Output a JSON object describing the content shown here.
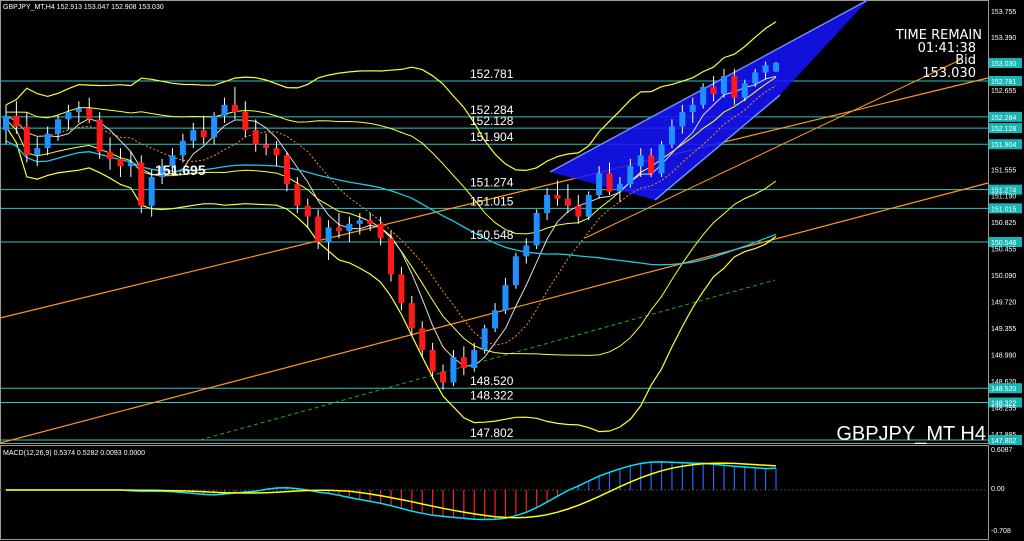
{
  "window": {
    "info_line": "GBPJPY_MT,H4  152.913 153.047 152.908 153.030"
  },
  "top_right": {
    "line1": "TIME REMAIN",
    "line2": "01:41:38",
    "line3": "Bid",
    "line4": "153.030"
  },
  "symbol_label": "GBPJPY_MT H4",
  "macd": {
    "label": "MACD(12,26,9) 0.5374 0.5282 0.0093 0.0000",
    "scale_labels": [
      "0.6087",
      "0.00",
      "-0.708"
    ],
    "colors": {
      "histogram": "#1e6bff",
      "negative": "#ff2020",
      "signal": "#ffff00",
      "main": "#00e5ff"
    }
  },
  "chart_data": {
    "type": "candlestick",
    "symbol": "GBPJPY_MT",
    "timeframe": "H4",
    "ylim": [
      147.65,
      153.95
    ],
    "price_axis_ticks": [
      "153.755",
      "153.390",
      "153.030",
      "152.781",
      "152.655",
      "152.284",
      "152.128",
      "151.904",
      "151.555",
      "151.274",
      "151.190",
      "151.015",
      "150.825",
      "150.548",
      "150.455",
      "150.090",
      "149.720",
      "149.355",
      "148.990",
      "148.620",
      "148.520",
      "148.322",
      "148.255",
      "147.885",
      "147.802"
    ],
    "horizontal_levels": [
      {
        "value": 152.781,
        "label": "152.781"
      },
      {
        "value": 152.284,
        "label": "152.284"
      },
      {
        "value": 152.128,
        "label": "152.128"
      },
      {
        "value": 151.904,
        "label": "151.904"
      },
      {
        "value": 151.274,
        "label": "151.274"
      },
      {
        "value": 151.015,
        "label": "151.015"
      },
      {
        "value": 150.548,
        "label": "150.548"
      },
      {
        "value": 148.52,
        "label": "148.520"
      },
      {
        "value": 148.322,
        "label": "148.322"
      },
      {
        "value": 147.802,
        "label": "147.802"
      }
    ],
    "highlighted_axis_labels": [
      "153.030",
      "152.781",
      "152.284",
      "152.128",
      "151.904",
      "151.274",
      "151.015",
      "150.548",
      "148.520",
      "148.322",
      "147.802"
    ],
    "annotation": "151.695",
    "candles": [
      [
        152.1,
        152.45,
        151.9,
        152.3
      ],
      [
        152.3,
        152.5,
        152.05,
        152.15
      ],
      [
        152.15,
        152.35,
        151.65,
        151.75
      ],
      [
        151.75,
        152.0,
        151.6,
        151.85
      ],
      [
        151.85,
        152.15,
        151.75,
        152.05
      ],
      [
        152.05,
        152.3,
        151.95,
        152.25
      ],
      [
        152.25,
        152.45,
        152.1,
        152.35
      ],
      [
        152.35,
        152.5,
        152.2,
        152.4
      ],
      [
        152.4,
        152.55,
        152.2,
        152.25
      ],
      [
        152.25,
        152.35,
        151.7,
        151.8
      ],
      [
        151.8,
        152.0,
        151.55,
        151.7
      ],
      [
        151.7,
        151.85,
        151.45,
        151.6
      ],
      [
        151.6,
        151.8,
        151.45,
        151.65
      ],
      [
        151.65,
        151.75,
        150.95,
        151.05
      ],
      [
        151.05,
        151.55,
        150.9,
        151.45
      ],
      [
        151.45,
        151.7,
        151.35,
        151.6
      ],
      [
        151.6,
        151.85,
        151.5,
        151.75
      ],
      [
        151.75,
        152.05,
        151.65,
        151.95
      ],
      [
        151.95,
        152.2,
        151.85,
        152.1
      ],
      [
        152.1,
        152.3,
        151.9,
        152.0
      ],
      [
        152.0,
        152.35,
        151.9,
        152.3
      ],
      [
        152.3,
        152.55,
        152.2,
        152.45
      ],
      [
        152.45,
        152.7,
        152.25,
        152.35
      ],
      [
        152.35,
        152.5,
        152.0,
        152.1
      ],
      [
        152.1,
        152.25,
        151.8,
        151.9
      ],
      [
        151.9,
        152.05,
        151.75,
        151.85
      ],
      [
        151.85,
        151.95,
        151.6,
        151.75
      ],
      [
        151.75,
        151.8,
        151.25,
        151.35
      ],
      [
        151.35,
        151.45,
        150.95,
        151.05
      ],
      [
        151.05,
        151.15,
        150.75,
        150.9
      ],
      [
        150.9,
        151.0,
        150.45,
        150.55
      ],
      [
        150.55,
        150.85,
        150.3,
        150.75
      ],
      [
        150.75,
        150.95,
        150.6,
        150.7
      ],
      [
        150.7,
        150.9,
        150.55,
        150.8
      ],
      [
        150.8,
        150.95,
        150.65,
        150.85
      ],
      [
        150.85,
        150.95,
        150.7,
        150.8
      ],
      [
        150.8,
        150.9,
        150.5,
        150.6
      ],
      [
        150.6,
        150.7,
        150.0,
        150.1
      ],
      [
        150.1,
        150.2,
        149.6,
        149.7
      ],
      [
        149.7,
        149.8,
        149.25,
        149.35
      ],
      [
        149.35,
        149.45,
        148.95,
        149.05
      ],
      [
        149.05,
        149.15,
        148.65,
        148.75
      ],
      [
        148.75,
        148.85,
        148.5,
        148.6
      ],
      [
        148.6,
        149.05,
        148.55,
        148.95
      ],
      [
        148.95,
        149.1,
        148.7,
        148.8
      ],
      [
        148.8,
        149.15,
        148.75,
        149.05
      ],
      [
        149.05,
        149.4,
        149.0,
        149.35
      ],
      [
        149.35,
        149.7,
        149.3,
        149.6
      ],
      [
        149.6,
        150.05,
        149.55,
        149.95
      ],
      [
        149.95,
        150.4,
        149.9,
        150.35
      ],
      [
        150.35,
        150.6,
        150.25,
        150.5
      ],
      [
        150.5,
        151.0,
        150.45,
        150.95
      ],
      [
        150.95,
        151.3,
        150.85,
        151.2
      ],
      [
        151.2,
        151.4,
        151.05,
        151.15
      ],
      [
        151.15,
        151.35,
        150.95,
        151.05
      ],
      [
        151.05,
        151.2,
        150.8,
        150.9
      ],
      [
        150.9,
        151.25,
        150.85,
        151.2
      ],
      [
        151.2,
        151.6,
        151.15,
        151.5
      ],
      [
        151.5,
        151.65,
        151.2,
        151.25
      ],
      [
        151.25,
        151.45,
        151.1,
        151.35
      ],
      [
        151.35,
        151.7,
        151.3,
        151.6
      ],
      [
        151.6,
        151.85,
        151.45,
        151.75
      ],
      [
        151.75,
        151.85,
        151.45,
        151.5
      ],
      [
        151.5,
        151.95,
        151.45,
        151.9
      ],
      [
        151.9,
        152.25,
        151.85,
        152.15
      ],
      [
        152.15,
        152.45,
        152.05,
        152.35
      ],
      [
        152.35,
        152.55,
        152.2,
        152.45
      ],
      [
        152.45,
        152.75,
        152.4,
        152.7
      ],
      [
        152.7,
        152.85,
        152.5,
        152.6
      ],
      [
        152.6,
        152.95,
        152.55,
        152.85
      ],
      [
        152.85,
        152.95,
        152.45,
        152.55
      ],
      [
        152.55,
        152.8,
        152.5,
        152.75
      ],
      [
        152.75,
        152.95,
        152.7,
        152.9
      ],
      [
        152.9,
        153.05,
        152.8,
        153.0
      ],
      [
        152.913,
        153.047,
        152.908,
        153.03
      ]
    ]
  }
}
